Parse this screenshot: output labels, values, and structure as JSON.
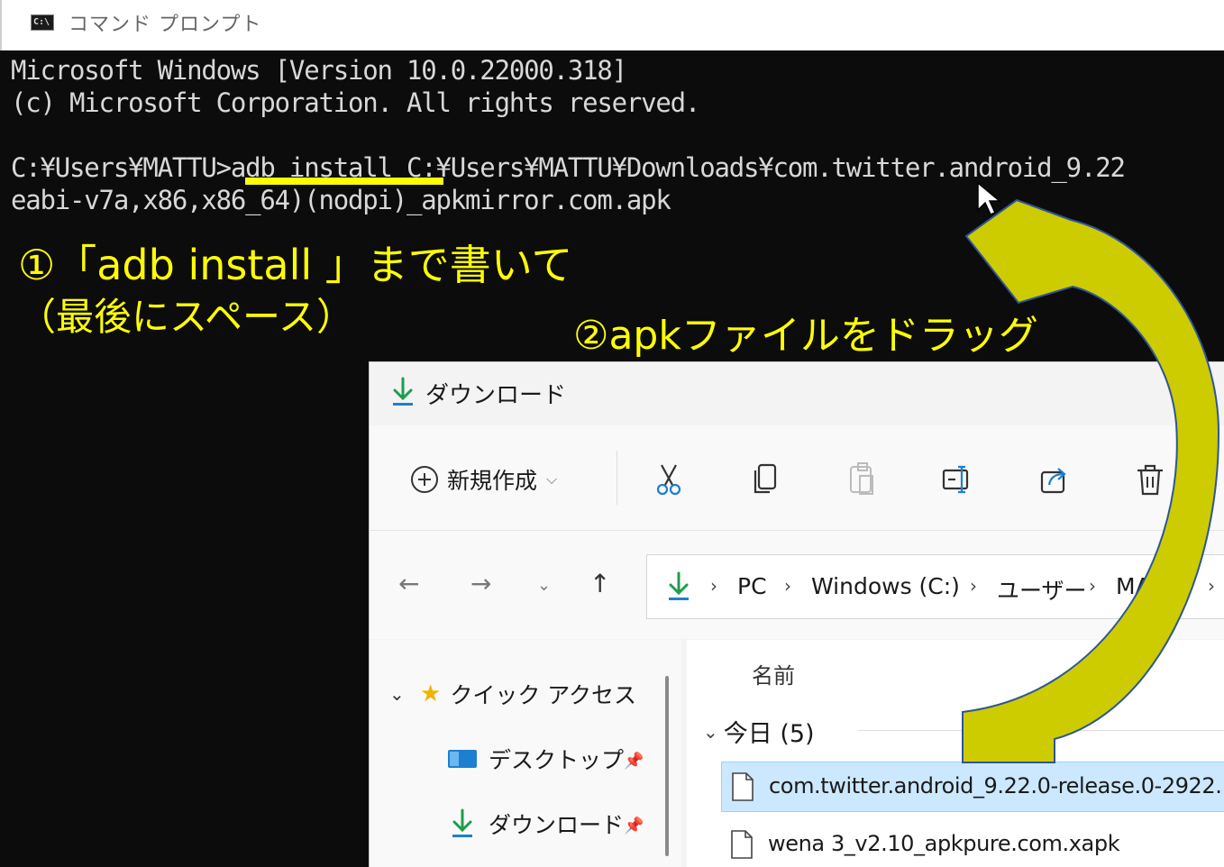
{
  "cmd": {
    "title": "コマンド プロンプト",
    "icon_text": "C:\\",
    "lines": [
      "Microsoft Windows [Version 10.0.22000.318]",
      "(c) Microsoft Corporation. All rights reserved.",
      "",
      "C:¥Users¥MATTU>adb install C:¥Users¥MATTU¥Downloads¥com.twitter.android_9.22",
      "eabi-v7a,x86,x86_64)(nodpi)_apkmirror.com.apk"
    ]
  },
  "annotations": {
    "step1_line1": "①「adb install 」まで書いて",
    "step1_line2": "（最後にスペース）",
    "step2": "②apkファイルをドラッグ"
  },
  "explorer": {
    "title": "ダウンロード",
    "toolbar": {
      "new_label": "新規作成",
      "icons": [
        "cut-icon",
        "copy-icon",
        "paste-icon",
        "rename-icon",
        "share-icon",
        "delete-icon"
      ]
    },
    "address": {
      "crumbs": [
        "PC",
        "Windows (C:)",
        "ユーザー",
        "MATTU"
      ]
    },
    "nav": {
      "quick_access": "クイック アクセス",
      "items": [
        {
          "label": "デスクトップ",
          "icon": "desktop-icon",
          "pinned": true
        },
        {
          "label": "ダウンロード",
          "icon": "download-icon",
          "pinned": true
        }
      ]
    },
    "files": {
      "column_name": "名前",
      "group_label": "今日 (5)",
      "rows": [
        {
          "name": "com.twitter.android_9.22.0-release.0-2922...",
          "selected": true
        },
        {
          "name": "wena 3_v2.10_apkpure.com.xapk",
          "selected": false
        }
      ]
    }
  },
  "colors": {
    "annotation": "#ffff00",
    "arrow_fill": "#cccc00",
    "arrow_stroke": "#2f5597",
    "selection": "#cce8ff"
  }
}
